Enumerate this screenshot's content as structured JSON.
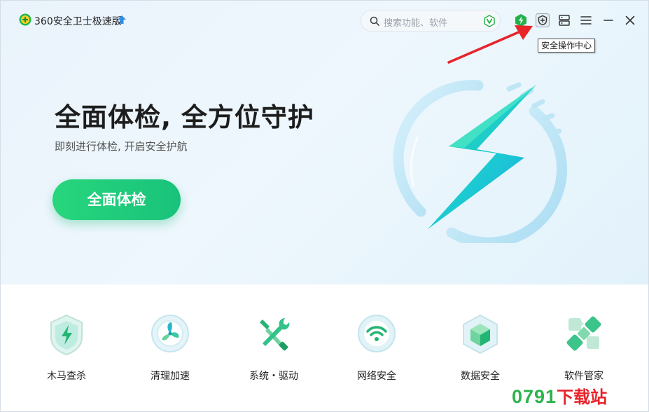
{
  "app": {
    "title": "360安全卫士极速版",
    "icons": {
      "logo": "360-logo-icon",
      "upgrade": "upgrade-arrow-icon"
    }
  },
  "search": {
    "placeholder": "搜索功能、软件",
    "icon": "search-icon",
    "badge_icon": "shield-v-icon"
  },
  "toolbar": {
    "icons": [
      "green-shield-lightning-icon",
      "security-center-shield-icon",
      "server-icon",
      "menu-icon",
      "minimize-icon",
      "close-icon"
    ],
    "tooltip": "安全操作中心"
  },
  "hero": {
    "headline": "全面体检, 全方位守护",
    "subline": "即刻进行体检, 开启安全护航",
    "scan_button": "全面体检"
  },
  "tools": [
    {
      "label": "木马查杀",
      "icon": "trojan-scan-icon"
    },
    {
      "label": "清理加速",
      "icon": "cleanup-speedup-icon"
    },
    {
      "label": "系统・驱动",
      "icon": "system-driver-tools-icon"
    },
    {
      "label": "网络安全",
      "icon": "wifi-security-icon"
    },
    {
      "label": "数据安全",
      "icon": "data-security-cube-icon"
    },
    {
      "label": "软件管家",
      "icon": "software-manager-icon"
    }
  ],
  "watermark": {
    "number": "0791",
    "text": "下载站"
  },
  "colors": {
    "accent_green": "#19c27b",
    "annotation_red": "#e8232a",
    "hero_bg": "#eaf3fb"
  }
}
